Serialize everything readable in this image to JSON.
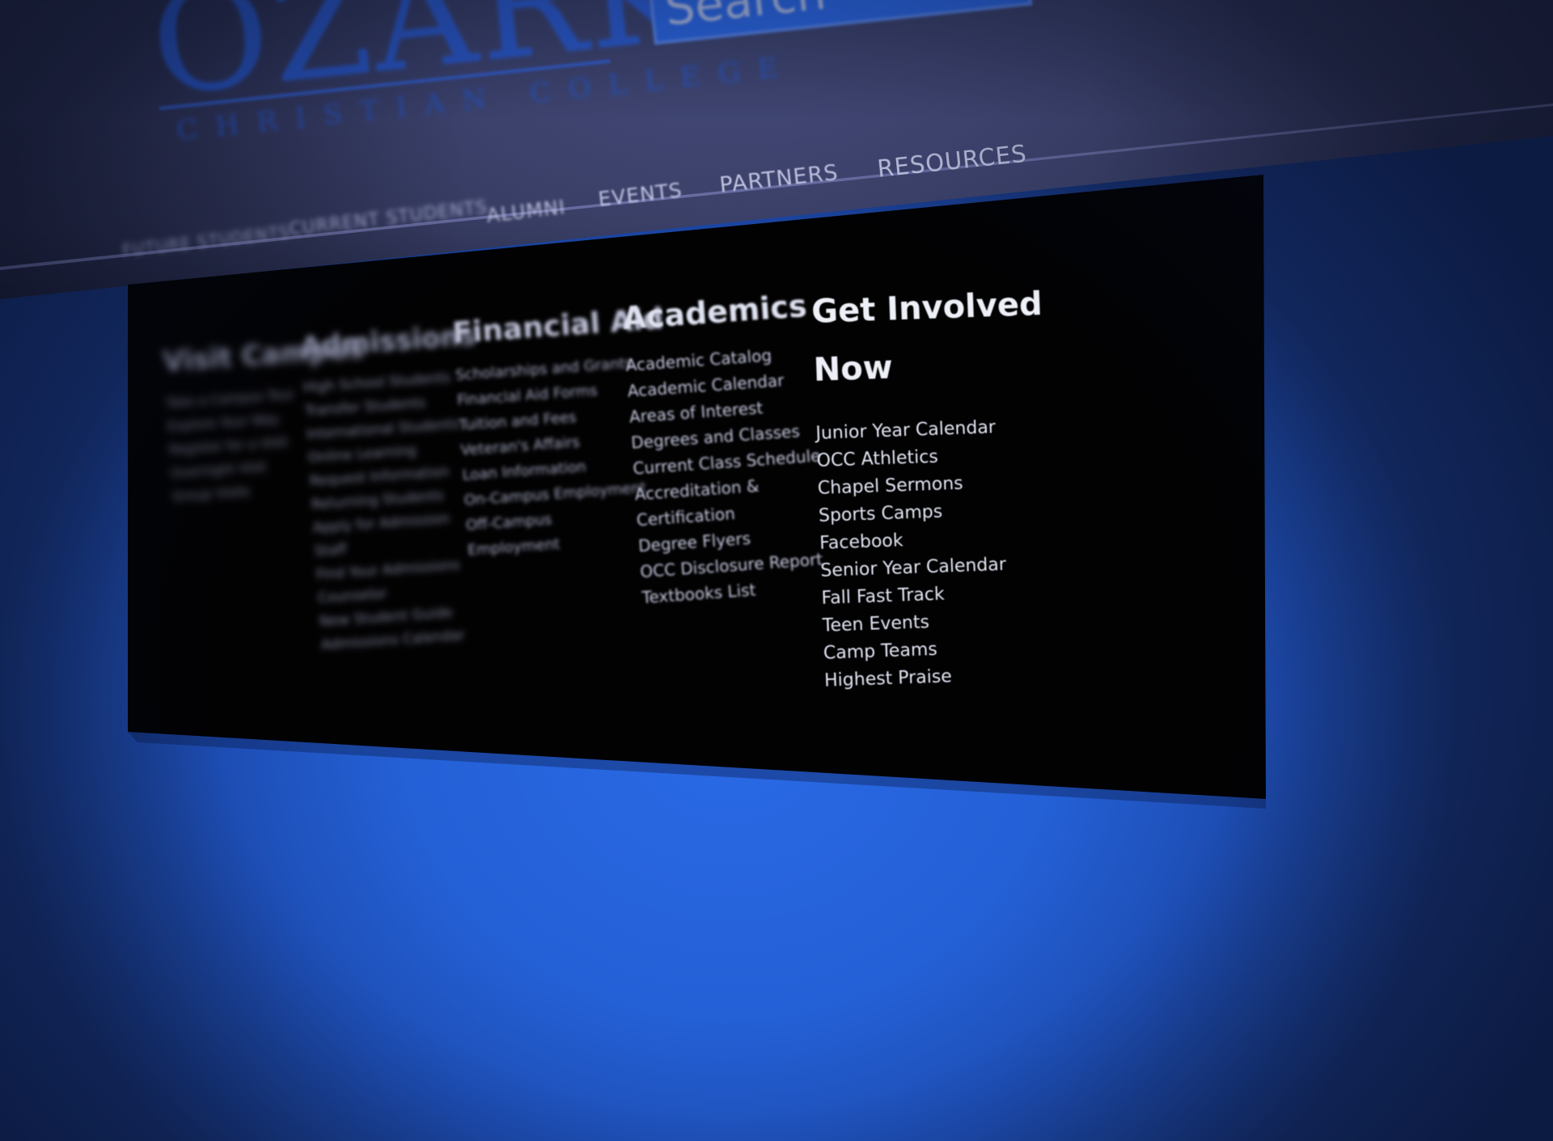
{
  "header": {
    "logo": {
      "main": "OZARK",
      "sub": "CHRISTIAN COLLEGE"
    },
    "search": {
      "placeholder": "Search"
    }
  },
  "nav": {
    "items": [
      {
        "label": "FUTURE STUDENTS"
      },
      {
        "label": "CURRENT STUDENTS"
      },
      {
        "label": "ALUMNI"
      },
      {
        "label": "EVENTS"
      },
      {
        "label": "PARTNERS"
      },
      {
        "label": "RESOURCES"
      }
    ]
  },
  "dropdown": {
    "columns": [
      {
        "heading": "Visit Campus",
        "items": [
          "Take a Campus Tour",
          "Explore Your Way",
          "Register for a Visit",
          "Overnight Visit",
          "Group Visits"
        ]
      },
      {
        "heading": "Admissions",
        "items": [
          "High School Students",
          "Transfer Students",
          "International Students",
          "Online Learning",
          "Request Information",
          "Returning Students",
          "Apply for Admission",
          "Staff",
          "Find Your Admissions",
          "Counselor",
          "New Student Guide",
          "Admissions Calendar"
        ]
      },
      {
        "heading": "Financial Aid",
        "items": [
          "Scholarships and Grants",
          "Financial Aid Forms",
          "Tuition and Fees",
          "Veteran's Affairs",
          "Loan Information",
          "On-Campus Employment",
          "Off-Campus",
          "Employment"
        ]
      },
      {
        "heading": "Academics",
        "items": [
          "Academic Catalog",
          "Academic Calendar",
          "Areas of Interest",
          "Degrees and Classes",
          "Current Class Schedule",
          "Accreditation &",
          "Certification",
          "Degree Flyers",
          "OCC Disclosure Report",
          "Textbooks List"
        ]
      },
      {
        "heading": "Get Involved Now",
        "items": [
          "Junior Year Calendar",
          "OCC Athletics",
          "Chapel Sermons",
          "Sports Camps",
          "Facebook",
          "Senior Year Calendar",
          "Fall Fast Track",
          "Teen Events",
          "Camp Teams",
          "Highest Praise"
        ]
      }
    ]
  },
  "colors": {
    "background_blue": "#2460d6",
    "header": "#4a5080",
    "panel": "#020203",
    "logo_blue": "#2f63e0",
    "search_blue": "#2e6ef2"
  }
}
